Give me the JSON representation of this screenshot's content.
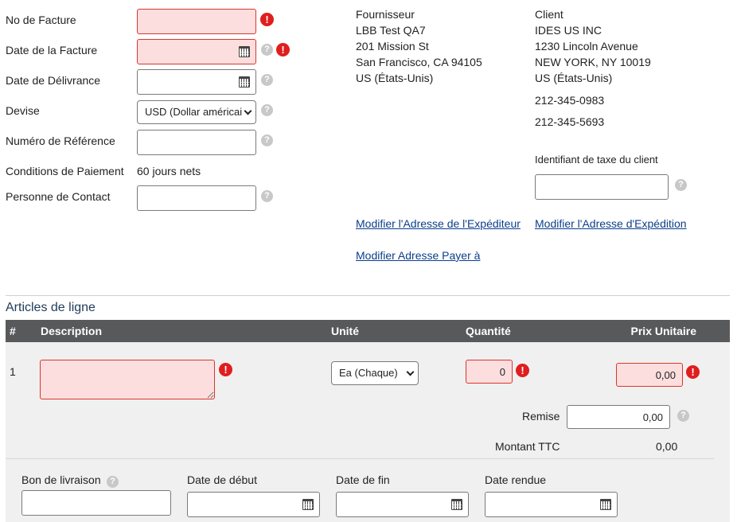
{
  "header_form": {
    "invoice_no_label": "No de Facture",
    "invoice_no_value": "",
    "invoice_date_label": "Date de la Facture",
    "invoice_date_value": "",
    "delivery_date_label": "Date de Délivrance",
    "delivery_date_value": "",
    "currency_label": "Devise",
    "currency_value": "USD (Dollar américai",
    "reference_label": "Numéro de Référence",
    "reference_value": "",
    "payment_terms_label": "Conditions de Paiement",
    "payment_terms_value": "60 jours nets",
    "contact_label": "Personne de Contact",
    "contact_value": ""
  },
  "supplier": {
    "heading": "Fournisseur",
    "name": "LBB Test QA7",
    "street": "201 Mission St",
    "city": "San Francisco, CA 94105",
    "country": "US (États-Unis)",
    "edit_link": "Modifier l'Adresse de l'Expéditeur",
    "pay_to_link": "Modifier Adresse Payer à"
  },
  "client": {
    "heading": "Client",
    "name": "IDES US INC",
    "street": "1230 Lincoln Avenue",
    "city": "NEW YORK, NY 10019",
    "country": "US (États-Unis)",
    "phone1": "212-345-0983",
    "phone2": "212-345-5693",
    "tax_id_label": "Identifiant de taxe du client",
    "tax_id_value": "",
    "edit_link": "Modifier l'Adresse d'Expédition"
  },
  "line_items": {
    "title": "Articles de ligne",
    "columns": {
      "num": "#",
      "description": "Description",
      "unit": "Unité",
      "quantity": "Quantité",
      "unit_price": "Prix Unitaire"
    },
    "row": {
      "num": "1",
      "description": "",
      "unit": "Ea (Chaque)",
      "quantity": "0",
      "unit_price": "0,00",
      "discount_label": "Remise",
      "discount_value": "0,00",
      "total_label": "Montant TTC",
      "total_value": "0,00",
      "delivery_note_label": "Bon de livraison",
      "delivery_note_value": "",
      "start_date_label": "Date de début",
      "start_date_value": "",
      "end_date_label": "Date de fin",
      "end_date_value": "",
      "rendered_date_label": "Date rendue",
      "rendered_date_value": ""
    }
  },
  "icons": {
    "help": "?",
    "error": "!"
  },
  "colors": {
    "error_bg": "#fcdede",
    "error_border": "#d9362e",
    "error_icon": "#e01e1e",
    "link": "#0b3e8c",
    "table_header": "#58595b"
  }
}
